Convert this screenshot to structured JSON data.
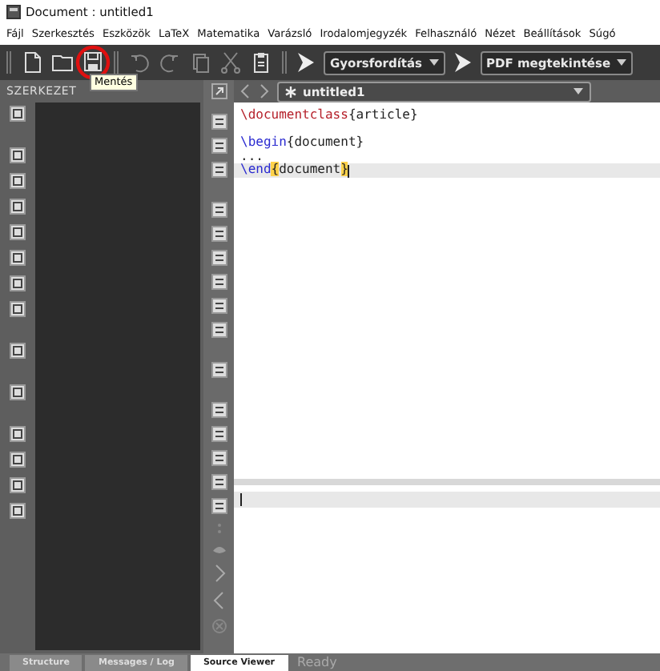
{
  "window": {
    "title": "Document : untitled1"
  },
  "menu": [
    "Fájl",
    "Szerkesztés",
    "Eszközök",
    "LaTeX",
    "Matematika",
    "Varázsló",
    "Irodalomjegyzék",
    "Felhasználó",
    "Nézet",
    "Beállítások",
    "Súgó"
  ],
  "toolbar": {
    "tooltip": "Mentés",
    "compile_combo": "Gyorsfordítás",
    "view_combo": "PDF megtekintése"
  },
  "structure_panel": {
    "title": "SZERKEZET"
  },
  "editor": {
    "tab": "untitled1",
    "lines": [
      {
        "current": false,
        "segments": [
          {
            "kind": "command",
            "text": "\\documentclass"
          },
          {
            "kind": "text",
            "text": "{article}"
          }
        ]
      },
      {
        "current": false
      },
      {
        "current": false,
        "segments": [
          {
            "kind": "keyword",
            "text": "\\begin"
          },
          {
            "kind": "text",
            "text": "{document}"
          }
        ]
      },
      {
        "current": false,
        "segments": [
          {
            "kind": "text",
            "text": "..."
          }
        ]
      },
      {
        "current": true,
        "segments": [
          {
            "kind": "keyword",
            "text": "\\end"
          },
          {
            "kind": "match",
            "text": "{"
          },
          {
            "kind": "text",
            "text": "document"
          },
          {
            "kind": "match",
            "text": "}"
          }
        ]
      }
    ]
  },
  "status_bar": {
    "tabs": [
      {
        "label": "Structure",
        "selected": false
      },
      {
        "label": "Messages / Log",
        "selected": false
      },
      {
        "label": "Source Viewer",
        "selected": true
      }
    ],
    "message": "Ready"
  }
}
